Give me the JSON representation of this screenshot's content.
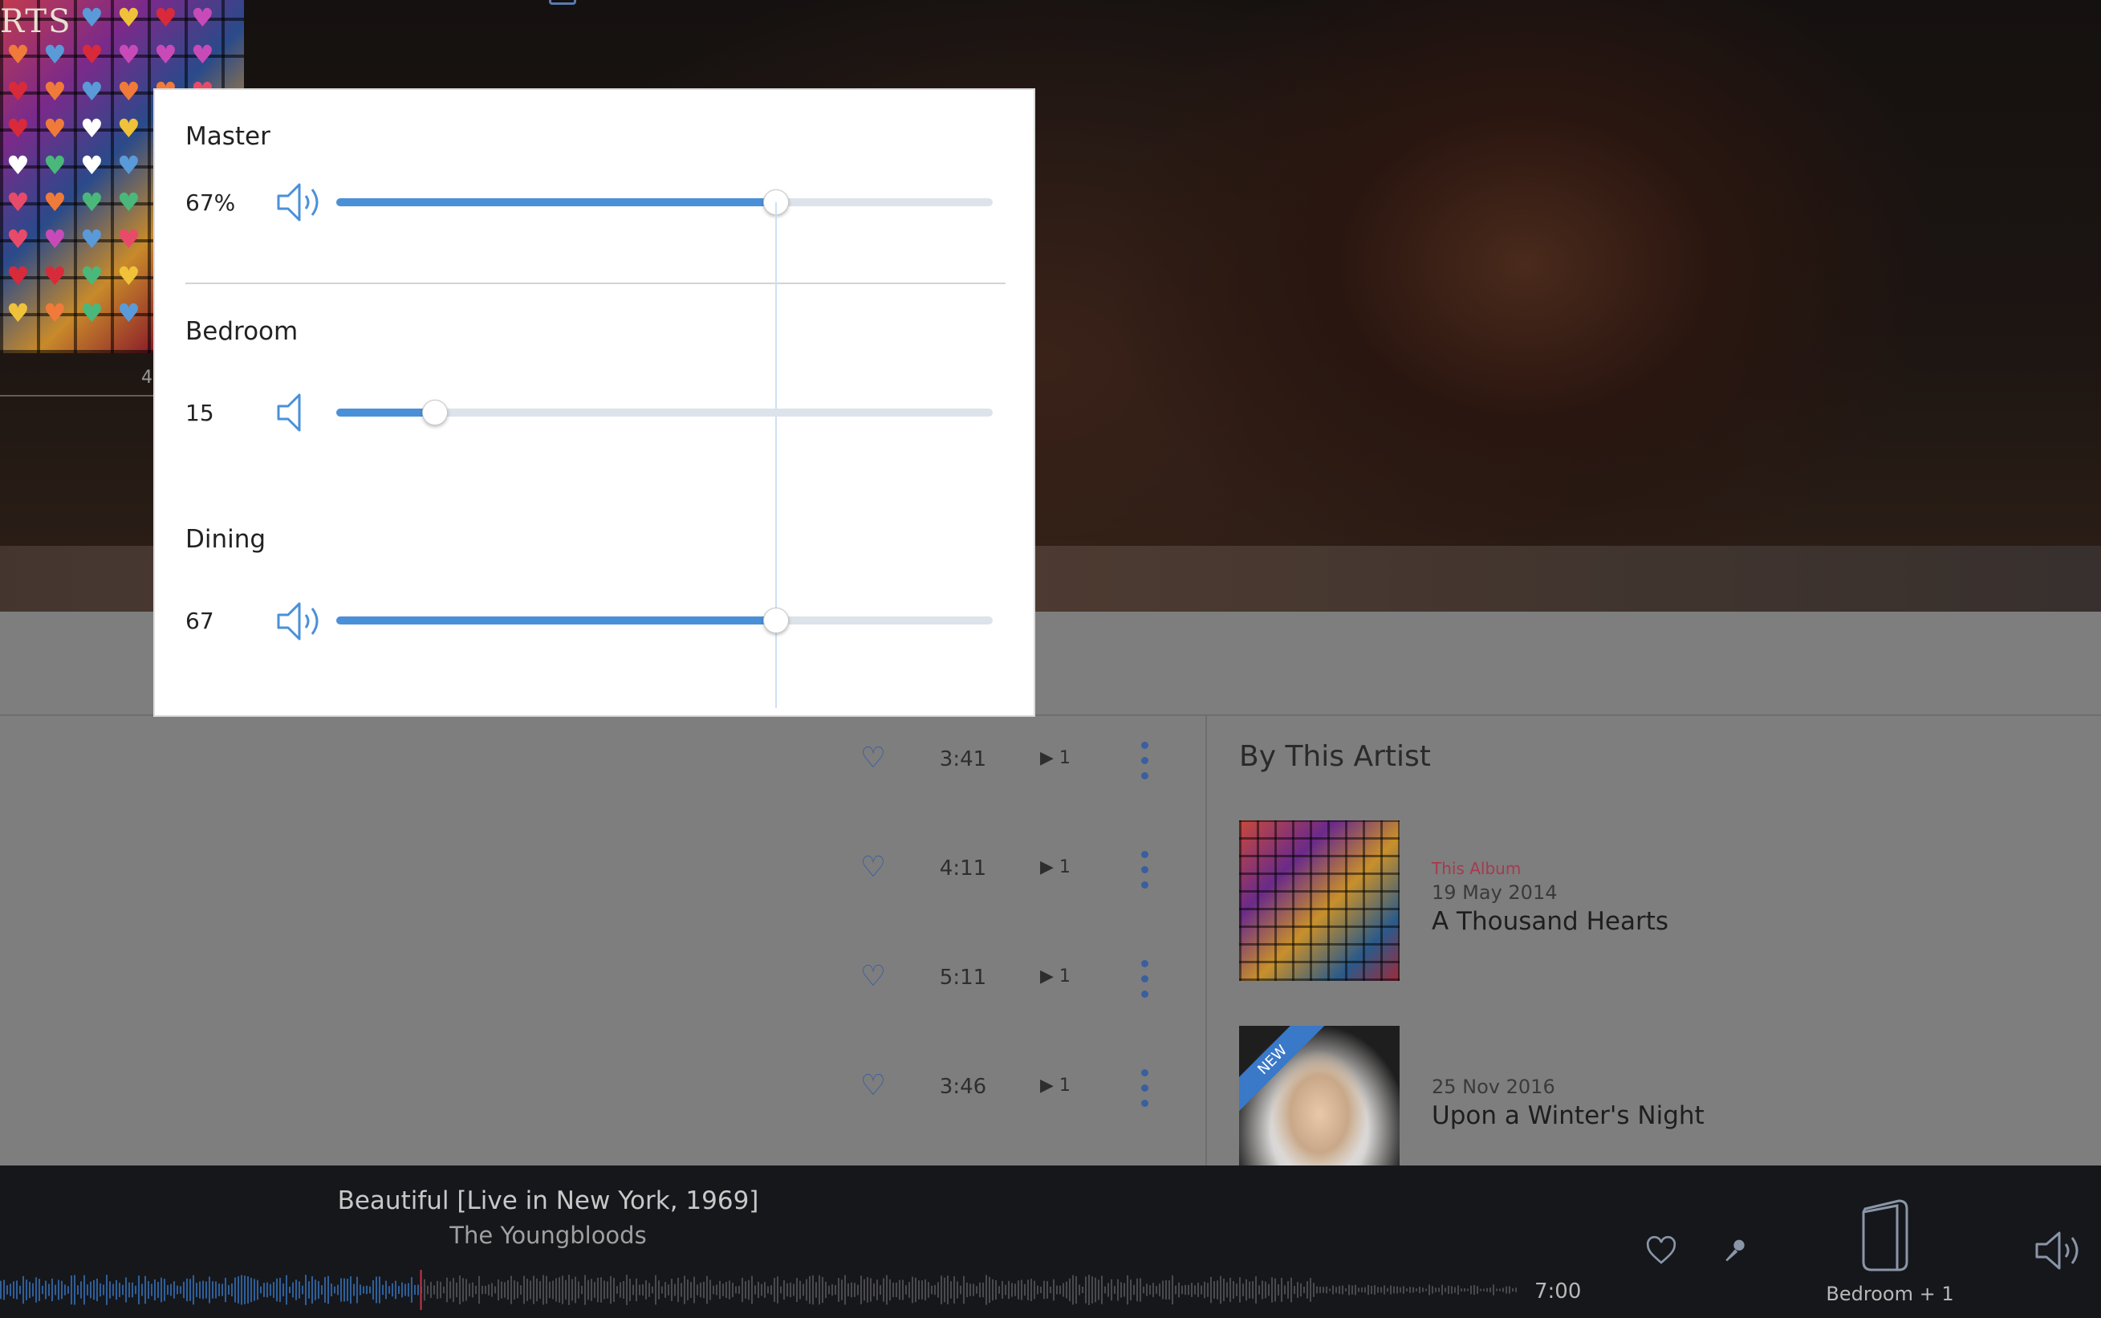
{
  "cover": {
    "title_fragment": "RTS",
    "hero_number": "4"
  },
  "tracks": [
    {
      "duration": "3:41",
      "plays": "1"
    },
    {
      "duration": "4:11",
      "plays": "1"
    },
    {
      "duration": "5:11",
      "plays": "1"
    },
    {
      "duration": "3:46",
      "plays": "1"
    }
  ],
  "by_artist": {
    "title": "By This Artist",
    "albums": [
      {
        "tag": "This Album",
        "date": "19 May 2014",
        "title": "A Thousand Hearts",
        "badge": ""
      },
      {
        "tag": "",
        "date": "25 Nov 2016",
        "title": "Upon a Winter's Night",
        "badge": "NEW"
      }
    ]
  },
  "player": {
    "track_title": "Beautiful [Live in New York, 1969]",
    "artist": "The Youngbloods",
    "duration": "7:00",
    "zone": "Bedroom + 1",
    "progress_fraction": 0.277
  },
  "volume_dialog": {
    "master": {
      "name": "Master",
      "value_label": "67%",
      "level": 67,
      "icon": "speaker-loud-icon"
    },
    "zones": [
      {
        "name": "Bedroom",
        "value_label": "15",
        "level": 15,
        "icon": "speaker-quiet-icon"
      },
      {
        "name": "Dining",
        "value_label": "67",
        "level": 67,
        "icon": "speaker-loud-icon"
      }
    ]
  },
  "colors": {
    "accent": "#4a90d9",
    "track_empty": "#dde3ea",
    "player_bg": "#16171b",
    "tag_red": "#a63a4e"
  }
}
